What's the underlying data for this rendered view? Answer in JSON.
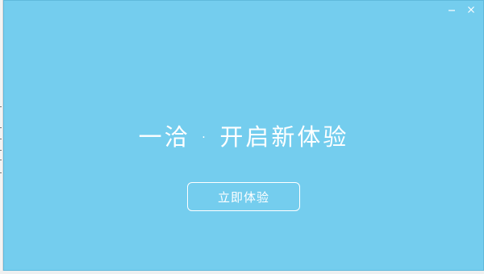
{
  "window": {
    "minimize_label": "–",
    "close_label": "×"
  },
  "main": {
    "headline": "一洽 · 开启新体验",
    "cta_label": "立即体验"
  },
  "colors": {
    "background": "#74cdee",
    "text": "#ffffff"
  }
}
